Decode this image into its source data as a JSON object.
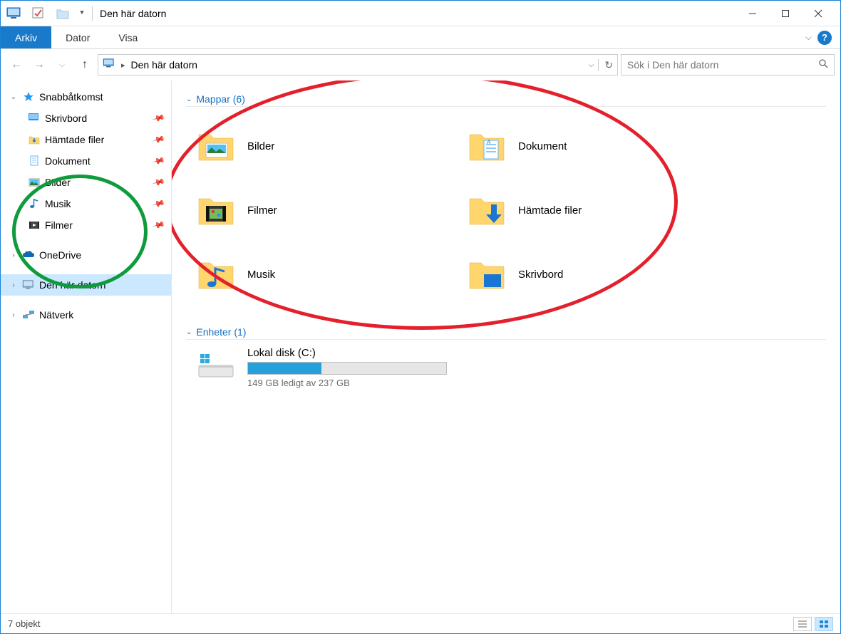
{
  "titlebar": {
    "title": "Den här datorn"
  },
  "ribbon": {
    "tabs": [
      "Arkiv",
      "Dator",
      "Visa"
    ],
    "active_index": 0
  },
  "navbar": {
    "breadcrumb_root": "Den här datorn",
    "search_placeholder": "Sök i Den här datorn"
  },
  "sidebar": {
    "quick_access": {
      "label": "Snabbåtkomst",
      "items": [
        {
          "label": "Skrivbord",
          "icon": "desktop"
        },
        {
          "label": "Hämtade filer",
          "icon": "downloads"
        },
        {
          "label": "Dokument",
          "icon": "documents"
        },
        {
          "label": "Bilder",
          "icon": "pictures"
        },
        {
          "label": "Musik",
          "icon": "music"
        },
        {
          "label": "Filmer",
          "icon": "videos"
        }
      ]
    },
    "onedrive_label": "OneDrive",
    "this_pc_label": "Den här datorn",
    "network_label": "Nätverk"
  },
  "main": {
    "sections": {
      "folders": {
        "header": "Mappar (6)",
        "items": [
          {
            "label": "Bilder",
            "icon": "pictures"
          },
          {
            "label": "Dokument",
            "icon": "documents"
          },
          {
            "label": "Filmer",
            "icon": "videos"
          },
          {
            "label": "Hämtade filer",
            "icon": "downloads"
          },
          {
            "label": "Musik",
            "icon": "music"
          },
          {
            "label": "Skrivbord",
            "icon": "desktop"
          }
        ]
      },
      "drives": {
        "header": "Enheter (1)",
        "items": [
          {
            "label": "Lokal disk (C:)",
            "free_text": "149 GB ledigt av 237 GB",
            "fill_percent": 37
          }
        ]
      }
    }
  },
  "statusbar": {
    "text": "7 objekt"
  }
}
